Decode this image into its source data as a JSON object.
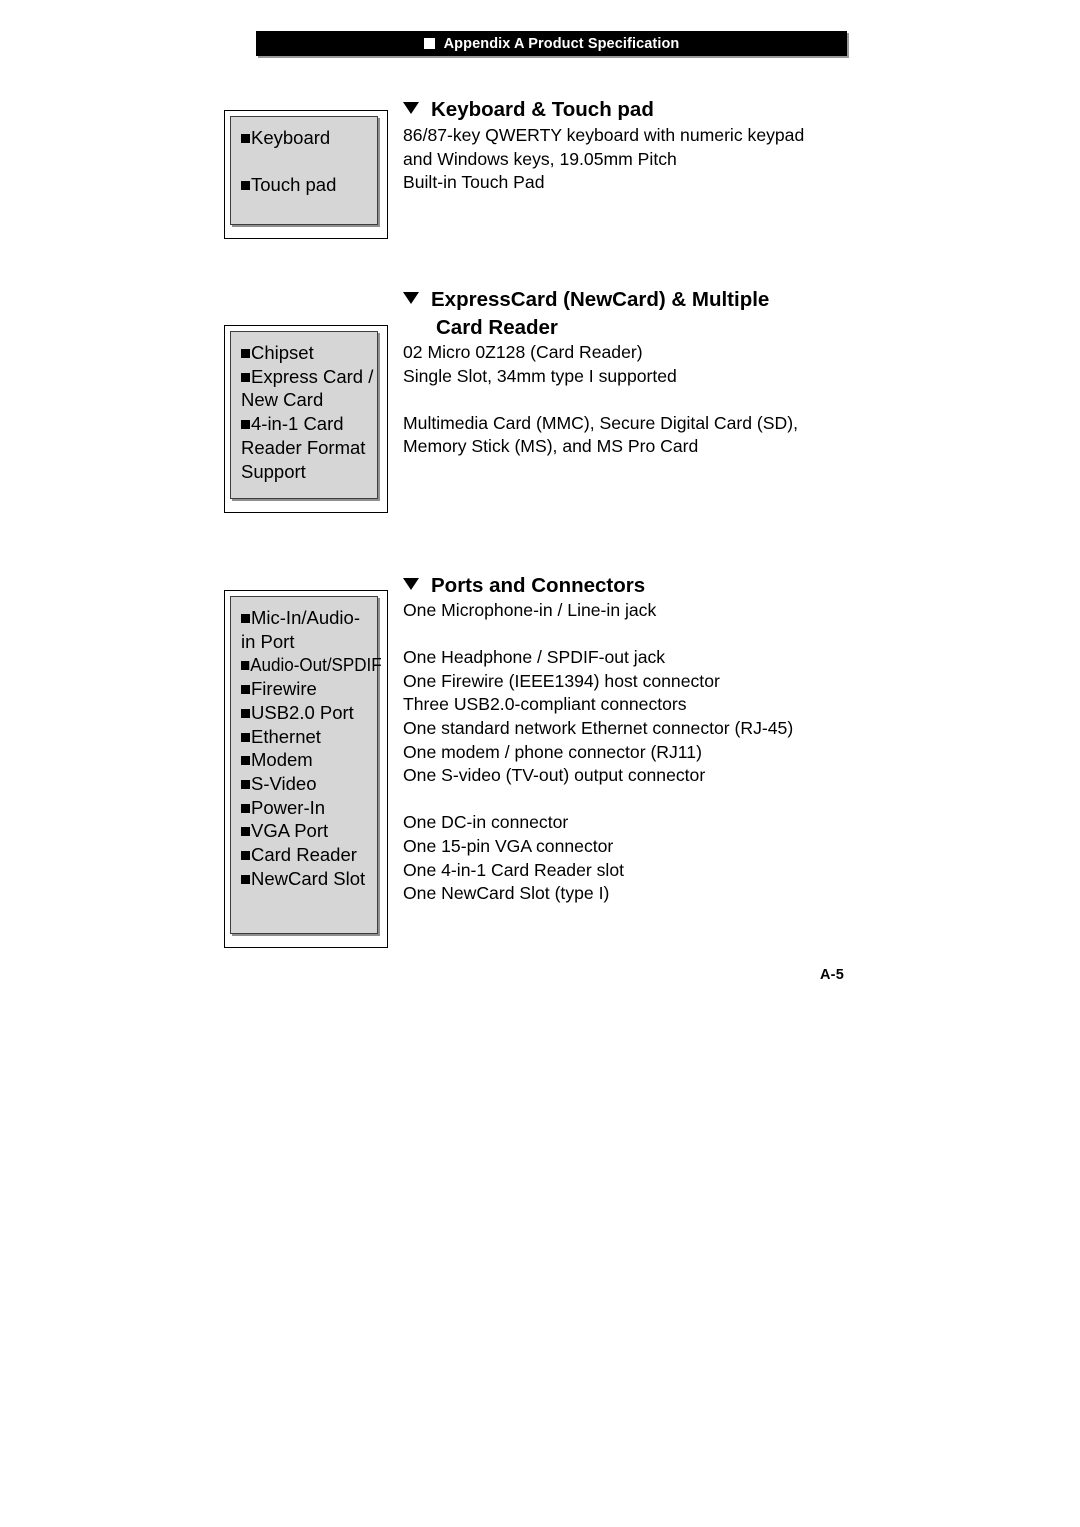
{
  "header": {
    "bullet_icon": "white-square-bullet",
    "title": "Appendix A Product Specification"
  },
  "page_number": "A-5",
  "colors": {
    "header_background": "#000000",
    "header_text": "#ffffff",
    "box_fill": "#d6d6d6",
    "box_border": "#000000",
    "page_background": "#ffffff",
    "text": "#000000"
  },
  "sections": [
    {
      "heading": {
        "bullet_icon": "triangle-down-icon",
        "line1": "Keyboard & Touch pad",
        "line2": ""
      },
      "labels": [
        {
          "bullet": true,
          "text": "Keyboard"
        },
        {
          "bullet": false,
          "text": ""
        },
        {
          "bullet": true,
          "text": "Touch pad"
        }
      ],
      "body": [
        "86/87-key QWERTY keyboard with numeric keypad",
        "and Windows keys, 19.05mm Pitch",
        "Built-in Touch Pad"
      ]
    },
    {
      "heading": {
        "bullet_icon": "triangle-down-icon",
        "line1": "ExpressCard (NewCard) & Multiple",
        "line2": "Card Reader"
      },
      "labels": [
        {
          "bullet": true,
          "text": "Chipset"
        },
        {
          "bullet": true,
          "text": "Express Card /"
        },
        {
          "bullet": false,
          "text": "New Card"
        },
        {
          "bullet": true,
          "text": "4-in-1 Card"
        },
        {
          "bullet": false,
          "text": "Reader Format"
        },
        {
          "bullet": false,
          "text": "Support"
        }
      ],
      "body": [
        "02 Micro 0Z128 (Card Reader)",
        "Single Slot, 34mm type I supported",
        "",
        "Multimedia Card (MMC), Secure Digital Card (SD),",
        "Memory Stick (MS), and MS Pro Card"
      ]
    },
    {
      "heading": {
        "bullet_icon": "triangle-down-icon",
        "line1": "Ports and Connectors",
        "line2": ""
      },
      "labels": [
        {
          "bullet": true,
          "text": "Mic-In/Audio-"
        },
        {
          "bullet": false,
          "text": "in Port"
        },
        {
          "bullet": true,
          "text": "Audio-Out/SPDIF"
        },
        {
          "bullet": true,
          "text": "Firewire"
        },
        {
          "bullet": true,
          "text": "USB2.0 Port"
        },
        {
          "bullet": true,
          "text": "Ethernet"
        },
        {
          "bullet": true,
          "text": "Modem"
        },
        {
          "bullet": true,
          "text": "S-Video"
        },
        {
          "bullet": true,
          "text": "Power-In"
        },
        {
          "bullet": true,
          "text": "VGA Port"
        },
        {
          "bullet": true,
          "text": "Card Reader"
        },
        {
          "bullet": true,
          "text": "NewCard Slot"
        }
      ],
      "body": [
        "One Microphone-in / Line-in jack",
        "",
        "One Headphone / SPDIF-out jack",
        "One Firewire (IEEE1394) host connector",
        "Three USB2.0-compliant connectors",
        "One standard network Ethernet connector (RJ-45)",
        "One modem / phone connector (RJ11)",
        "One S-video (TV-out) output connector",
        "",
        "One DC-in connector",
        "One 15-pin VGA connector",
        "One 4-in-1 Card Reader slot",
        "One NewCard Slot (type I)"
      ]
    }
  ]
}
